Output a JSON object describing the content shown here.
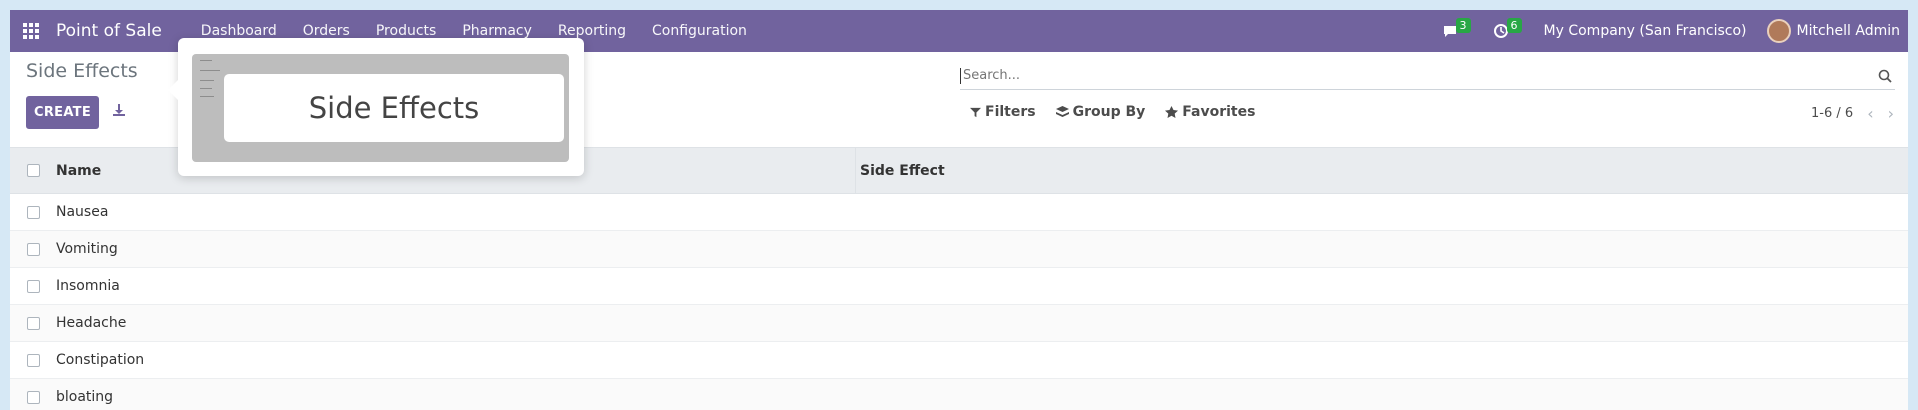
{
  "navbar": {
    "brand": "Point of Sale",
    "menu": [
      "Dashboard",
      "Orders",
      "Products",
      "Pharmacy",
      "Reporting",
      "Configuration"
    ],
    "messages_count": "3",
    "activities_count": "6",
    "company": "My Company (San Francisco)",
    "user": "Mitchell Admin",
    "accent_color": "#71639e"
  },
  "control_panel": {
    "breadcrumb": "Side Effects",
    "create_label": "CREATE",
    "search_placeholder": "Search...",
    "filters_label": "Filters",
    "group_by_label": "Group By",
    "favorites_label": "Favorites",
    "pager": "1-6 / 6"
  },
  "table": {
    "columns": [
      "Name",
      "Side Effect"
    ],
    "rows": [
      "Nausea",
      "Vomiting",
      "Insomnia",
      "Headache",
      "Constipation",
      "bloating"
    ]
  },
  "tooltip": {
    "title": "Side Effects"
  }
}
